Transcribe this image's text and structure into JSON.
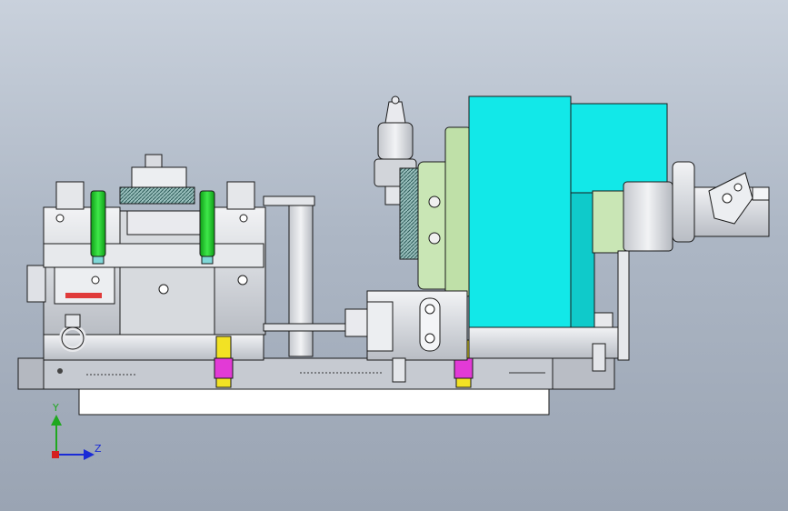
{
  "viewport": {
    "background_top": "#c9d1dc",
    "background_bottom": "#9aa4b3"
  },
  "triad": {
    "y_label": "Y",
    "z_label": "Z",
    "y_color": "#1fa81f",
    "z_color": "#1a2bd6",
    "origin_color": "#d42020"
  },
  "colors": {
    "cyan_block": "#12e8e8",
    "green_part": "#1fd02a",
    "magenta_part": "#e23ad6",
    "yellow_part": "#f2e224",
    "pale_green": "#c9e6b5",
    "gray_part": "#d9dbe0",
    "dark_line": "#1a1a1a"
  }
}
